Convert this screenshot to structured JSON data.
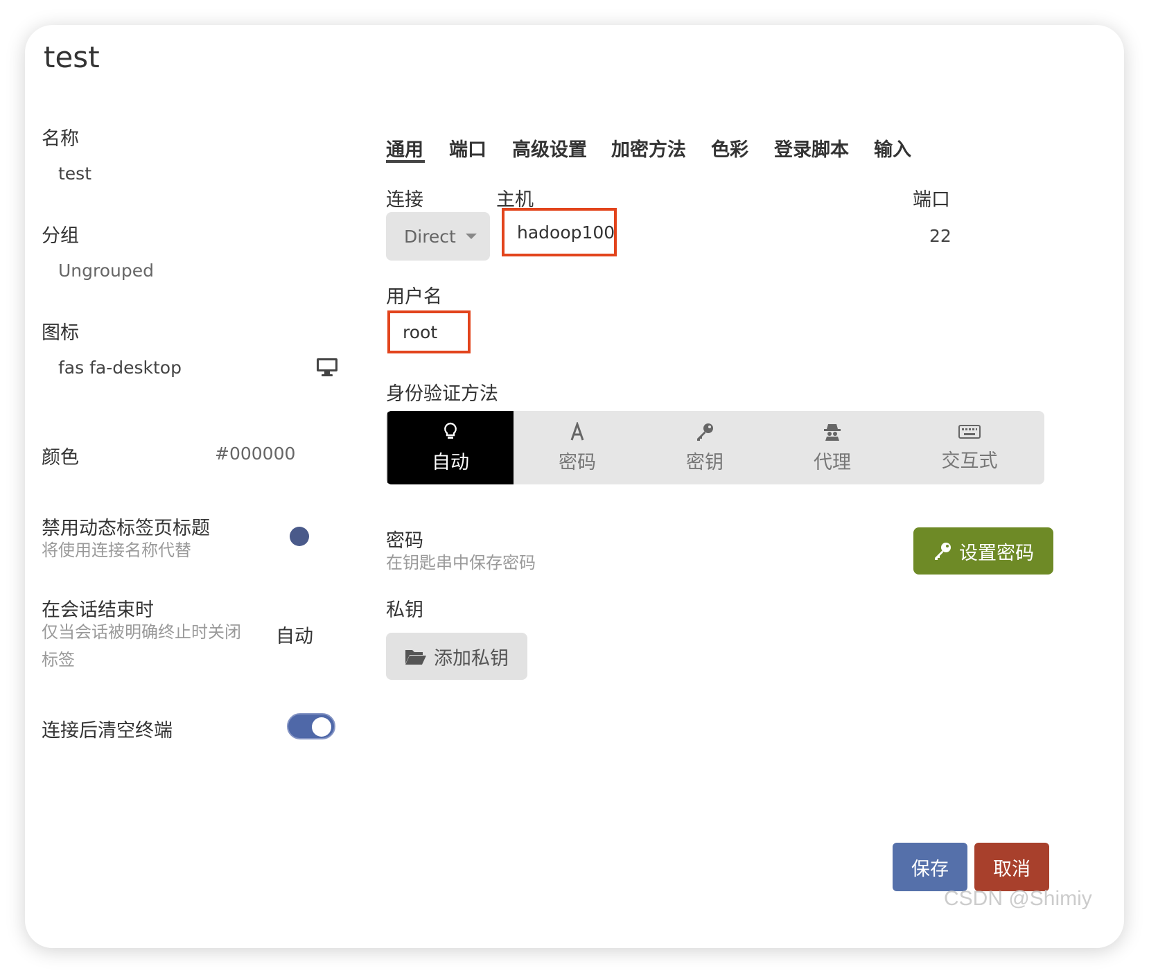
{
  "dialog": {
    "title": "test"
  },
  "left": {
    "name_label": "名称",
    "name_value": "test",
    "group_label": "分组",
    "group_value": "Ungrouped",
    "icon_label": "图标",
    "icon_value": "fas fa-desktop",
    "color_label": "颜色",
    "color_value": "#000000",
    "dynamic_tab_label": "禁用动态标签页标题",
    "dynamic_tab_sub": "将使用连接名称代替",
    "session_end_label": "在会话结束时",
    "session_end_sub": "仅当会话被明确终止时关闭标签",
    "session_end_value": "自动",
    "clear_terminal_label": "连接后清空终端"
  },
  "tabs": [
    "通用",
    "端口",
    "高级设置",
    "加密方法",
    "色彩",
    "登录脚本",
    "输入"
  ],
  "general": {
    "connection_label": "连接",
    "connection_value": "Direct",
    "host_label": "主机",
    "host_value": "hadoop100",
    "port_label": "端口",
    "port_value": "22",
    "username_label": "用户名",
    "username_value": "root",
    "auth_label": "身份验证方法",
    "auth_options": [
      "自动",
      "密码",
      "密钥",
      "代理",
      "交互式"
    ],
    "password_label": "密码",
    "password_sub": "在钥匙串中保存密码",
    "set_password_button": "设置密码",
    "private_key_label": "私钥",
    "add_private_key_button": "添加私钥"
  },
  "footer": {
    "save": "保存",
    "cancel": "取消"
  },
  "watermark": "CSDN @Shimiy",
  "colors": {
    "highlight_border": "#e2441c",
    "save": "#5570aa",
    "cancel": "#a8402c",
    "set_password": "#6e8a26",
    "toggle": "#4f68a8"
  }
}
